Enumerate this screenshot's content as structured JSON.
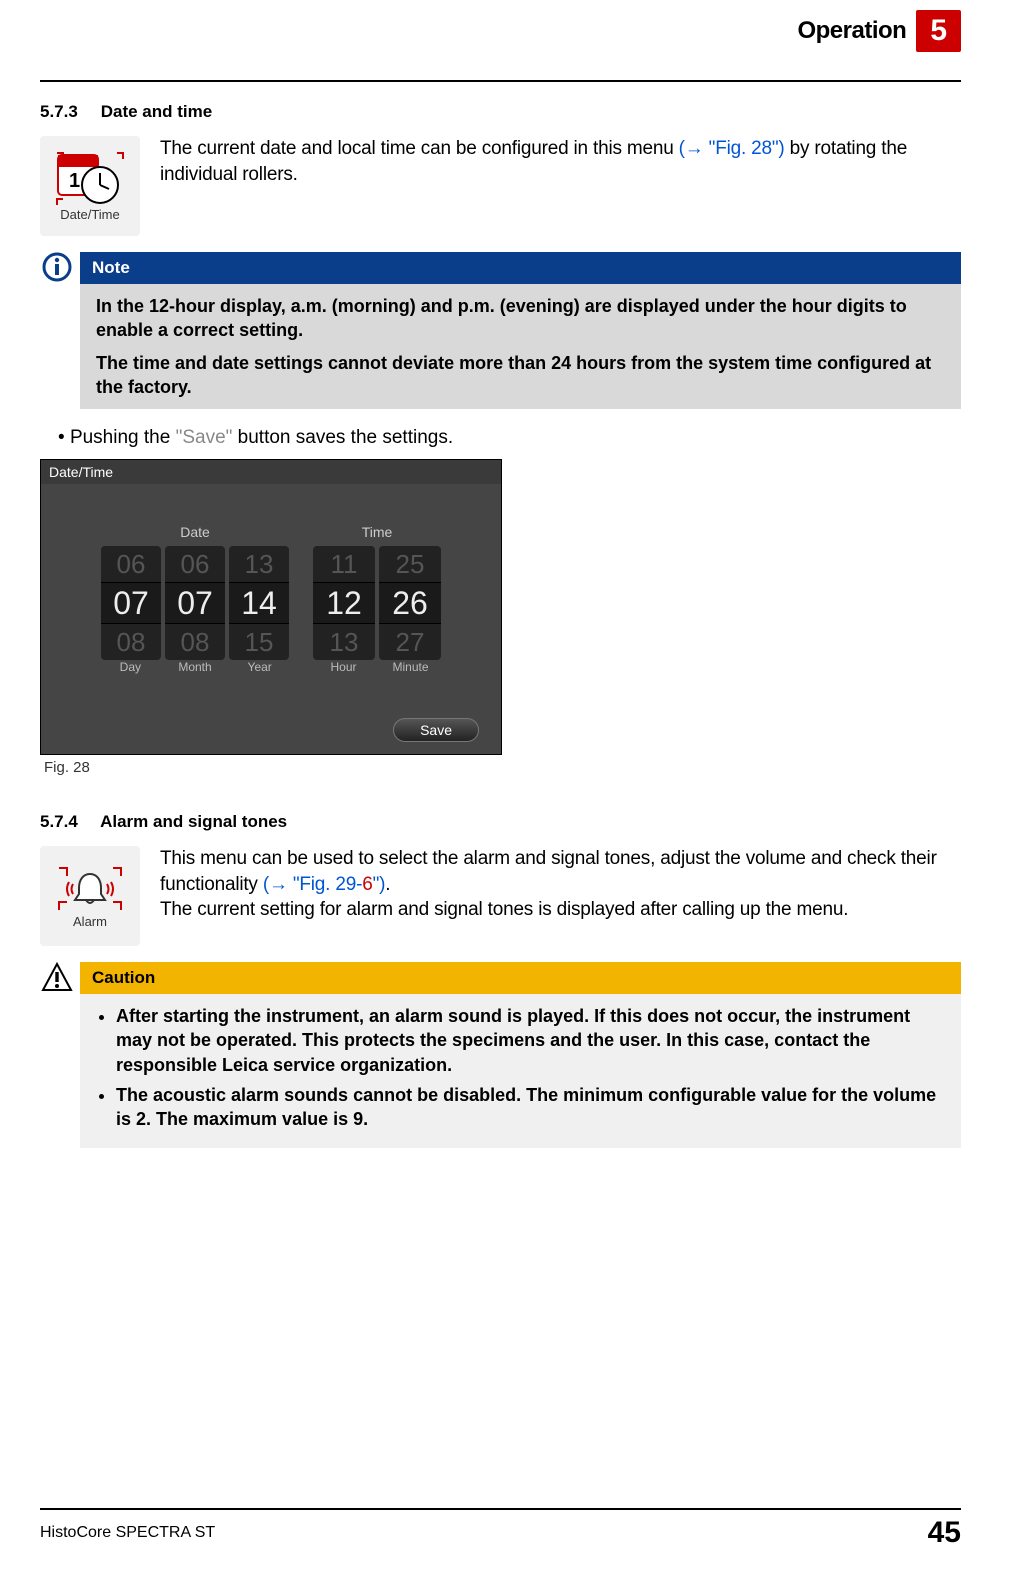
{
  "header": {
    "chapter_title": "Operation",
    "chapter_number": "5"
  },
  "section573": {
    "number": "5.7.3",
    "title": "Date and time",
    "icon_label": "Date/Time",
    "intro_a": "The current date and local time can be configured in this menu ",
    "intro_link": "(→ \"Fig. 28\")",
    "intro_b": " by rotating the individual rollers."
  },
  "note": {
    "title": "Note",
    "p1": "In the 12-hour display, a.m. (morning) and p.m. (evening) are displayed under the hour digits to enable a correct setting.",
    "p2": "The time and date settings cannot deviate more than 24 hours from the system time configured at the factory."
  },
  "bullet_save_a": "Pushing the ",
  "bullet_save_word": "\"Save\"",
  "bullet_save_b": " button saves the settings.",
  "figure28": {
    "window_title": "Date/Time",
    "date_label": "Date",
    "time_label": "Time",
    "day": {
      "prev": "06",
      "cur": "07",
      "next": "08",
      "label": "Day"
    },
    "month": {
      "prev": "06",
      "cur": "07",
      "next": "08",
      "label": "Month"
    },
    "year": {
      "prev": "13",
      "cur": "14",
      "next": "15",
      "label": "Year"
    },
    "hour": {
      "prev": "11",
      "cur": "12",
      "next": "13",
      "label": "Hour"
    },
    "minute": {
      "prev": "25",
      "cur": "26",
      "next": "27",
      "label": "Minute"
    },
    "save_button": "Save",
    "caption": "Fig. 28"
  },
  "section574": {
    "number": "5.7.4",
    "title": "Alarm and signal tones",
    "icon_label": "Alarm",
    "p1a": "This menu can be used to select the alarm and signal tones, adjust the volume and check their functionality ",
    "p1_link": "(→ \"Fig. 29-",
    "p1_link_red": "6",
    "p1_link_close": "\")",
    "p1b": ".",
    "p2": "The current setting for alarm and signal tones is displayed after calling up the menu."
  },
  "caution": {
    "title": "Caution",
    "item1": "After starting the instrument, an alarm sound is played. If this does not occur, the instrument may not be operated. This protects the specimens and the user. In this case, contact the responsible Leica service organization.",
    "item2": "The acoustic alarm sounds cannot be disabled. The minimum configurable value for the volume is 2. The maximum value is 9."
  },
  "footer": {
    "product": "HistoCore SPECTRA ST",
    "page": "45"
  }
}
